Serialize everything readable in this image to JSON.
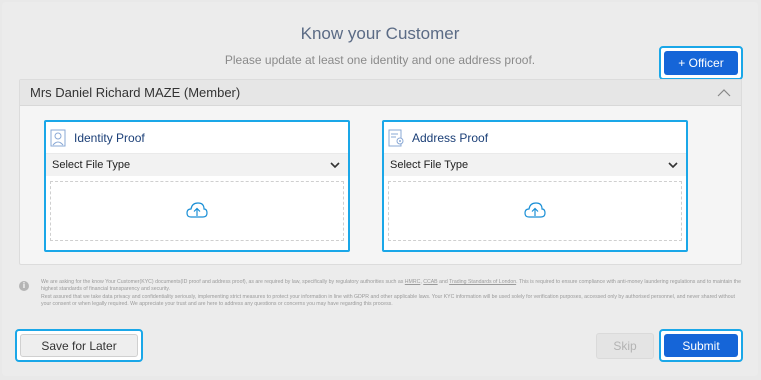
{
  "header": {
    "title": "Know your Customer",
    "subtitle": "Please update at least one identity and one address proof.",
    "officer_button": {
      "icon": "plus-icon",
      "label": "+ Officer"
    }
  },
  "member": {
    "name": "Mrs Daniel Richard MAZE (Member)",
    "collapse_icon": "chevron-up-icon",
    "proofs": [
      {
        "title": "Identity Proof",
        "icon": "id-card-icon",
        "select_value": "Select File Type",
        "upload_icon": "cloud-upload-icon"
      },
      {
        "title": "Address Proof",
        "icon": "address-document-icon",
        "select_value": "Select File Type",
        "upload_icon": "cloud-upload-icon"
      }
    ]
  },
  "disclaimer": {
    "part1": "We are asking for the know Your Customer(KYC) documents(ID proof and address proof), as are required by law, specifically by regulatory authorities such as ",
    "link_hmrc": "HMRC",
    "sep1": ", ",
    "link_ccab": "CCAB",
    "sep2": " and ",
    "link_tsl": "Trading Standards of London",
    "part2": ". This is required to ensure compliance with anti-money laundering regulations and to maintain the highest standards of financial transparency and security.",
    "part3": "Rest assured that we take data privacy and confidentiality seriously, implementing strict measures to protect your information in line with GDPR and other applicable laws. Your KYC information will be used solely for verification purposes, accessed only by authorised personnel, and never shared without your consent or when legally required. We appreciate your trust and are here to address any questions or concerns you may have regarding this process."
  },
  "footer": {
    "save_label": "Save for Later",
    "skip_label": "Skip",
    "submit_label": "Submit"
  },
  "colors": {
    "primary": "#1565d8",
    "highlight": "#1aa7e8",
    "title": "#5b6b85"
  }
}
